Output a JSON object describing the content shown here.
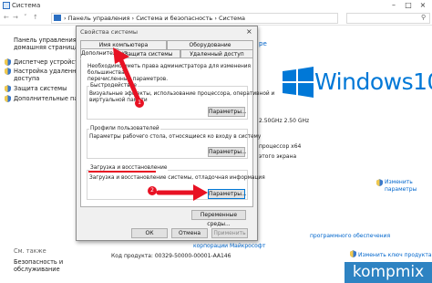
{
  "window": {
    "title": "Система"
  },
  "address": {
    "crumbs": [
      "Панель управления",
      "Система и безопасность",
      "Система"
    ],
    "sep": "›"
  },
  "left_pane": {
    "home_link": [
      "Панель управления —",
      "домашняя страница"
    ],
    "items": [
      {
        "label": [
          "Диспетчер устройств"
        ]
      },
      {
        "label": [
          "Настройка удаленного",
          "доступа"
        ]
      },
      {
        "label": [
          "Защита системы"
        ]
      },
      {
        "label": [
          "Дополнительные парамет"
        ]
      }
    ],
    "see_also": "См. также",
    "security": [
      "Безопасность и",
      "обслуживание"
    ]
  },
  "right_pane": {
    "link_fragment": "ре",
    "windows_logo_text": "Windows10",
    "lines": [
      "2.50GHz 2.50 GHz",
      "процессор x64",
      "этого экрана"
    ],
    "params_link": [
      "Изменить",
      "параметры"
    ],
    "ms_link": "программного обеспечения",
    "license_link": "Изменить ключ продукта",
    "ms_corp": "корпорации Майкрософт",
    "product_code": "Код продукта: 00329-50000-00001-AA146"
  },
  "dialog": {
    "title": "Свойства системы",
    "tabs_row1": [
      "Имя компьютера",
      "Оборудование"
    ],
    "tabs_row2": [
      "Дополнительно",
      "Защита системы",
      "Удаленный доступ"
    ],
    "admin_note": [
      "Необходимо иметь права администратора для изменения большинства",
      "перечисленных параметров."
    ],
    "perf": {
      "title": "Быстродействие",
      "text": [
        "Визуальные эффекты, использование процессора, оперативной и",
        "виртуальной памяти"
      ],
      "button": "Параметры..."
    },
    "profiles": {
      "title": "Профили пользователей",
      "text": [
        "Параметры рабочего стола, относящиеся ко входу в систему"
      ],
      "button": "Параметры..."
    },
    "startup": {
      "title": "Загрузка и восстановление",
      "text": [
        "Загрузка и восстановление системы, отладочная информация"
      ],
      "button": "Параметры..."
    },
    "env_button": "Переменные среды...",
    "ok": "ОК",
    "cancel": "Отмена",
    "apply": "Применить"
  },
  "annotations": {
    "step1": "1",
    "step2": "2"
  },
  "watermark": "kompmix",
  "colors": {
    "accent": "#0078d7",
    "annotation": "#e81123",
    "watermark_bg": "#2e83c2"
  }
}
